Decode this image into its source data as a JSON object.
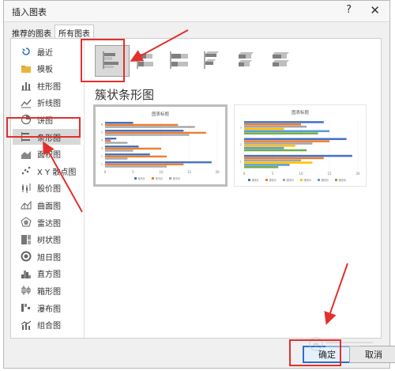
{
  "dialog": {
    "title": "插入图表",
    "help_label": "?",
    "close_label": "✕"
  },
  "tabs": [
    {
      "label": "推荐的图表"
    },
    {
      "label": "所有图表"
    }
  ],
  "sidebar": {
    "items": [
      {
        "label": "最近",
        "icon": "recent-icon"
      },
      {
        "label": "模板",
        "icon": "folder-icon"
      },
      {
        "label": "柱形图",
        "icon": "column-chart-icon"
      },
      {
        "label": "折线图",
        "icon": "line-chart-icon"
      },
      {
        "label": "饼图",
        "icon": "pie-chart-icon"
      },
      {
        "label": "条形图",
        "icon": "bar-chart-icon"
      },
      {
        "label": "面积图",
        "icon": "area-chart-icon"
      },
      {
        "label": "X Y 散点图",
        "icon": "scatter-chart-icon"
      },
      {
        "label": "股价图",
        "icon": "stock-chart-icon"
      },
      {
        "label": "曲面图",
        "icon": "surface-chart-icon"
      },
      {
        "label": "雷达图",
        "icon": "radar-chart-icon"
      },
      {
        "label": "树状图",
        "icon": "treemap-chart-icon"
      },
      {
        "label": "旭日图",
        "icon": "sunburst-chart-icon"
      },
      {
        "label": "直方图",
        "icon": "histogram-chart-icon"
      },
      {
        "label": "箱形图",
        "icon": "box-chart-icon"
      },
      {
        "label": "瀑布图",
        "icon": "waterfall-chart-icon"
      },
      {
        "label": "组合图",
        "icon": "combo-chart-icon"
      }
    ],
    "selected_index": 5
  },
  "subtypes": [
    {
      "icon": "clustered-bar-icon",
      "selected": true
    },
    {
      "icon": "stacked-bar-icon",
      "selected": false
    },
    {
      "icon": "100-stacked-bar-icon",
      "selected": false
    },
    {
      "icon": "3d-clustered-bar-icon",
      "selected": false
    },
    {
      "icon": "3d-stacked-bar-icon",
      "selected": false
    },
    {
      "icon": "3d-100-stacked-bar-icon",
      "selected": false
    }
  ],
  "section_title": "簇状条形图",
  "previews": [
    {
      "chart_title": "图表标题",
      "legend": [
        "系列1",
        "系列2",
        "系列3"
      ],
      "x_ticks": [
        "0",
        "5",
        "10",
        "15",
        "20"
      ]
    },
    {
      "chart_title": "图表标题",
      "legend": [
        "类别1",
        "类别2",
        "类别3",
        "类别4",
        "类别5",
        "类别6"
      ],
      "x_ticks": [
        "0",
        "5",
        "10",
        "15",
        "20"
      ]
    }
  ],
  "buttons": {
    "ok": "确定",
    "cancel": "取消"
  },
  "watermark": "Baidu经验",
  "colors": {
    "series": [
      "#4472c4",
      "#ed7d31",
      "#a5a5a5",
      "#ffc000",
      "#5b9bd5",
      "#70ad47"
    ],
    "highlight": "#e2302d",
    "ok_border": "#2b6fd1"
  },
  "chart_data": [
    {
      "type": "bar",
      "title": "图表标题",
      "categories": [
        "1",
        "2",
        "3",
        "4",
        "5",
        "6"
      ],
      "series": [
        {
          "name": "系列1",
          "values": [
            19,
            8,
            6,
            2,
            14,
            5
          ]
        },
        {
          "name": "系列2",
          "values": [
            14,
            11,
            10,
            1,
            18,
            13
          ]
        },
        {
          "name": "系列3",
          "values": [
            11,
            4,
            5,
            4,
            15,
            16
          ]
        }
      ],
      "xlim": [
        0,
        20
      ]
    },
    {
      "type": "bar",
      "title": "图表标题",
      "categories": [
        "1",
        "2",
        "3"
      ],
      "series": [
        {
          "name": "类别1",
          "values": [
            19,
            18,
            14
          ]
        },
        {
          "name": "类别2",
          "values": [
            14,
            15,
            10
          ]
        },
        {
          "name": "类别3",
          "values": [
            10,
            12,
            11
          ]
        },
        {
          "name": "类别4",
          "values": [
            12,
            9,
            7
          ]
        },
        {
          "name": "类别5",
          "values": [
            8,
            7,
            15
          ]
        },
        {
          "name": "类别6",
          "values": [
            6,
            11,
            13
          ]
        }
      ],
      "xlim": [
        0,
        20
      ]
    }
  ]
}
